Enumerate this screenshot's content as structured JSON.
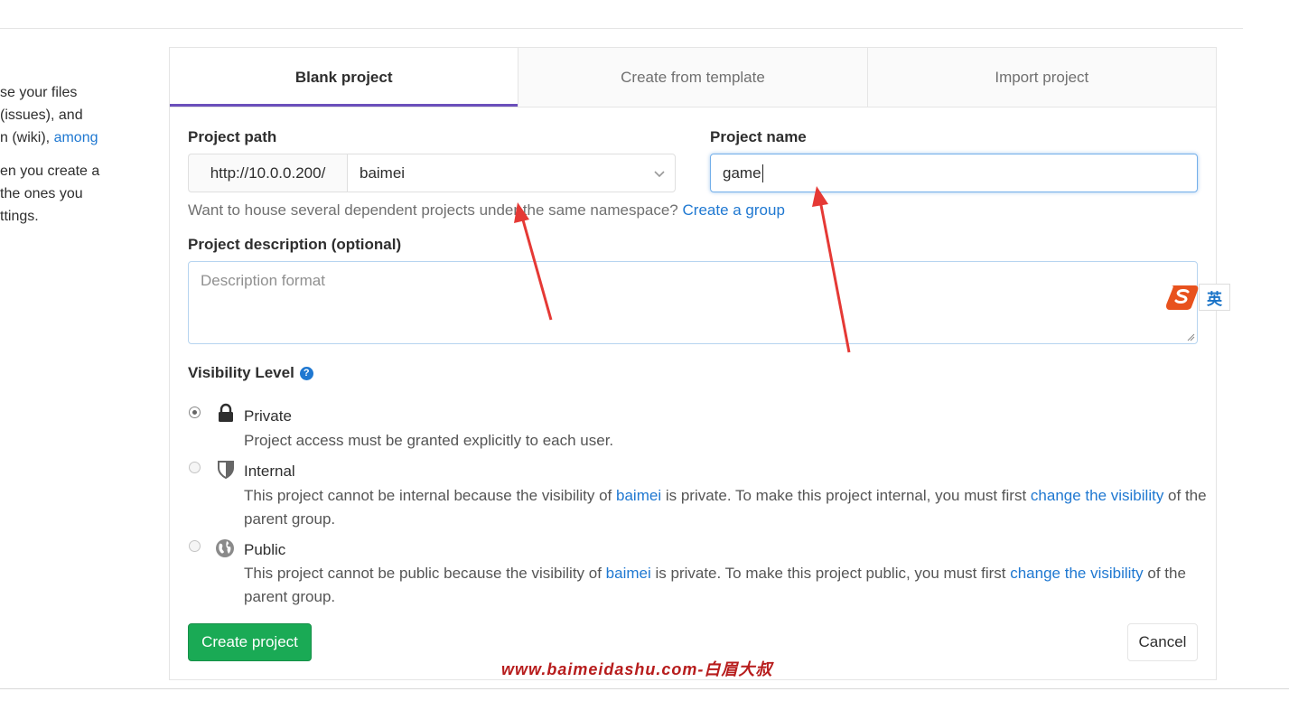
{
  "left_info": {
    "p1_line1": "se your files",
    "p1_line2": " (issues), and",
    "p1_line3_text": "n (wiki), ",
    "p1_line3_link": "among",
    "p2_line1": "en you create a",
    "p2_line2": " the ones you",
    "p2_line3": "ttings."
  },
  "tabs": [
    {
      "label": "Blank project",
      "active": true
    },
    {
      "label": "Create from template",
      "active": false
    },
    {
      "label": "Import project",
      "active": false
    }
  ],
  "form": {
    "project_path_label": "Project path",
    "url_prefix": "http://10.0.0.200/",
    "namespace_value": "baimei",
    "project_name_label": "Project name",
    "project_name_value": "game",
    "help_text": "Want to house several dependent projects under the same namespace? ",
    "help_link": "Create a group",
    "description_label": "Project description (optional)",
    "description_placeholder": "Description format",
    "visibility_label": "Visibility Level"
  },
  "visibility": {
    "private": {
      "title": "Private",
      "text": "Project access must be granted explicitly to each user.",
      "checked": true
    },
    "internal": {
      "title": "Internal",
      "text_a": "This project cannot be internal because the visibility of ",
      "link_a": "baimei",
      "text_b": " is private. To make this project internal, you must first ",
      "link_b": "change the visibility",
      "text_c": " of the parent group.",
      "checked": false
    },
    "public": {
      "title": "Public",
      "text_a": "This project cannot be public because the visibility of ",
      "link_a": "baimei",
      "text_b": " is private. To make this project public, you must first ",
      "link_b": "change the visibility",
      "text_c": " of the parent group.",
      "checked": false
    }
  },
  "buttons": {
    "create": "Create project",
    "cancel": "Cancel"
  },
  "ime": {
    "label": "英"
  },
  "watermark": "www.baimeidashu.com-白眉大叔",
  "colors": {
    "primary_link": "#1f78d1",
    "active_tab_underline": "#6b4fbb",
    "create_button": "#1aaa55",
    "annotation_arrow": "#e53935"
  }
}
